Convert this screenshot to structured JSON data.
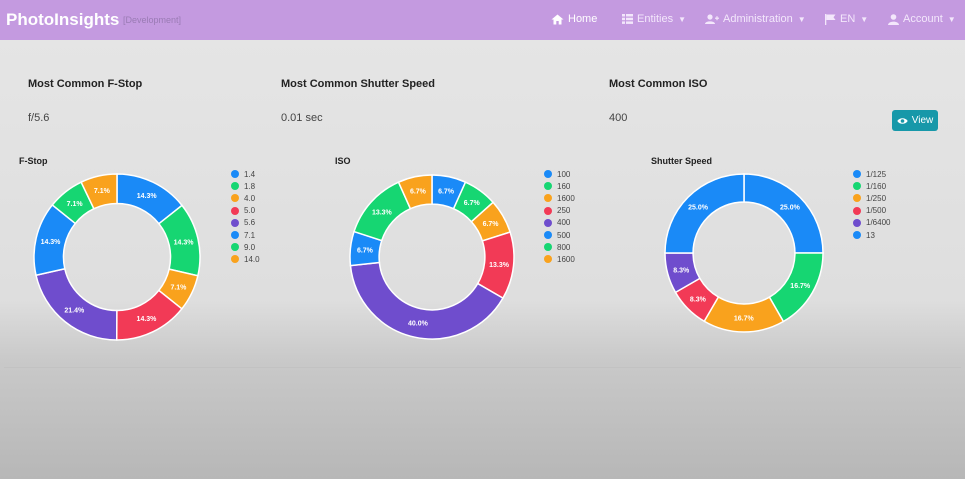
{
  "navbar": {
    "brand": "PhotoInsights",
    "brand_sub": "[Development]",
    "home": "Home",
    "entities": "Entities",
    "administration": "Administration",
    "language": "EN",
    "account": "Account"
  },
  "stats": [
    {
      "title": "Most Common F-Stop",
      "value": "f/5.6"
    },
    {
      "title": "Most Common Shutter Speed",
      "value": "0.01 sec"
    },
    {
      "title": "Most Common ISO",
      "value": "400"
    }
  ],
  "view_button": "View",
  "charts": [
    {
      "title": "F-Stop",
      "chart_data": {
        "type": "donut",
        "categories": [
          "1.4",
          "1.8",
          "4.0",
          "5.0",
          "5.6",
          "7.1",
          "9.0",
          "14.0"
        ],
        "values": [
          14.3,
          14.3,
          7.1,
          14.3,
          21.4,
          14.3,
          7.1,
          7.1
        ],
        "labels": [
          "14.3%",
          "14.3%",
          "7.1%",
          "14.3%",
          "21.4%",
          "14.3%",
          "7.1%",
          "7.1%"
        ],
        "colors": [
          "#1a8af7",
          "#16d672",
          "#f9a21d",
          "#f23a56",
          "#6f4dcd",
          "#1a8af7",
          "#16d672",
          "#f9a21d"
        ]
      }
    },
    {
      "title": "ISO",
      "chart_data": {
        "type": "donut",
        "categories": [
          "100",
          "160",
          "1600",
          "250",
          "400",
          "500",
          "800",
          "1600"
        ],
        "values": [
          6.7,
          6.7,
          6.7,
          13.3,
          40.0,
          6.7,
          13.3,
          6.7
        ],
        "labels": [
          "6.7%",
          "6.7%",
          "6.7%",
          "13.3%",
          "40.0%",
          "6.7%",
          "13.3%",
          "6.7%"
        ],
        "colors": [
          "#1a8af7",
          "#16d672",
          "#f9a21d",
          "#f23a56",
          "#6f4dcd",
          "#1a8af7",
          "#16d672",
          "#f9a21d"
        ]
      }
    },
    {
      "title": "Shutter Speed",
      "chart_data": {
        "type": "donut",
        "categories": [
          "1/125",
          "1/160",
          "1/250",
          "1/500",
          "1/6400",
          "13"
        ],
        "values": [
          25.0,
          16.7,
          16.7,
          8.3,
          8.3,
          25.0
        ],
        "labels": [
          "25.0%",
          "16.7%",
          "16.7%",
          "8.3%",
          "8.3%",
          "25.0%"
        ],
        "colors": [
          "#1a8af7",
          "#16d672",
          "#f9a21d",
          "#f23a56",
          "#6f4dcd",
          "#1a8af7"
        ]
      }
    }
  ]
}
